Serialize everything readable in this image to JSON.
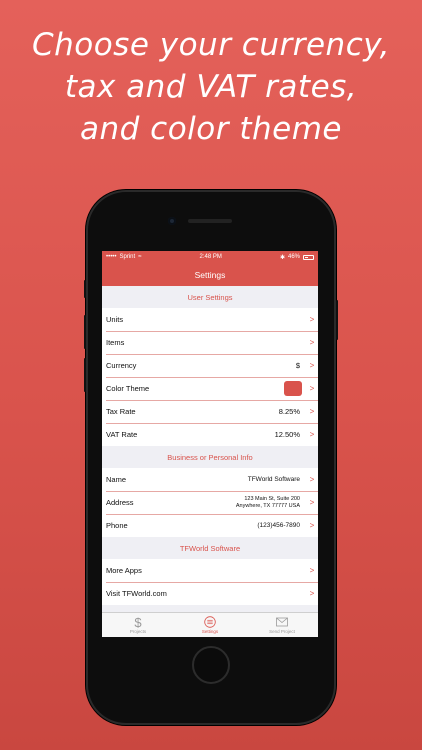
{
  "headline": {
    "line1": "Choose your currency,",
    "line2": "tax and VAT rates,",
    "line3": "and color theme"
  },
  "status_bar": {
    "carrier": "Sprint",
    "time": "2:48 PM",
    "battery": "46%"
  },
  "nav": {
    "title": "Settings"
  },
  "sections": {
    "user_settings": {
      "title": "User Settings",
      "rows": [
        {
          "label": "Units",
          "value": ""
        },
        {
          "label": "Items",
          "value": ""
        },
        {
          "label": "Currency",
          "value": "$"
        },
        {
          "label": "Color Theme",
          "value": ""
        },
        {
          "label": "Tax Rate",
          "value": "8.25%"
        },
        {
          "label": "VAT Rate",
          "value": "12.50%"
        }
      ]
    },
    "business": {
      "title": "Business or Personal Info",
      "rows": [
        {
          "label": "Name",
          "value": "TFWorld Software"
        },
        {
          "label": "Address",
          "value_line1": "123 Main St, Suite 200",
          "value_line2": "Anywhere, TX 77777 USA"
        },
        {
          "label": "Phone",
          "value": "(123)456-7890"
        }
      ]
    },
    "tfworld": {
      "title": "TFWorld Software",
      "rows": [
        {
          "label": "More Apps"
        },
        {
          "label": "Visit TFWorld.com"
        }
      ]
    }
  },
  "chevron": ">",
  "tabs": [
    {
      "label": "Projects",
      "icon": "dollar-icon"
    },
    {
      "label": "Settings",
      "icon": "list-icon"
    },
    {
      "label": "Send Project",
      "icon": "envelope-icon"
    }
  ],
  "colors": {
    "accent": "#d9534c",
    "background_top": "#e4615a",
    "background_bottom": "#c94740"
  }
}
